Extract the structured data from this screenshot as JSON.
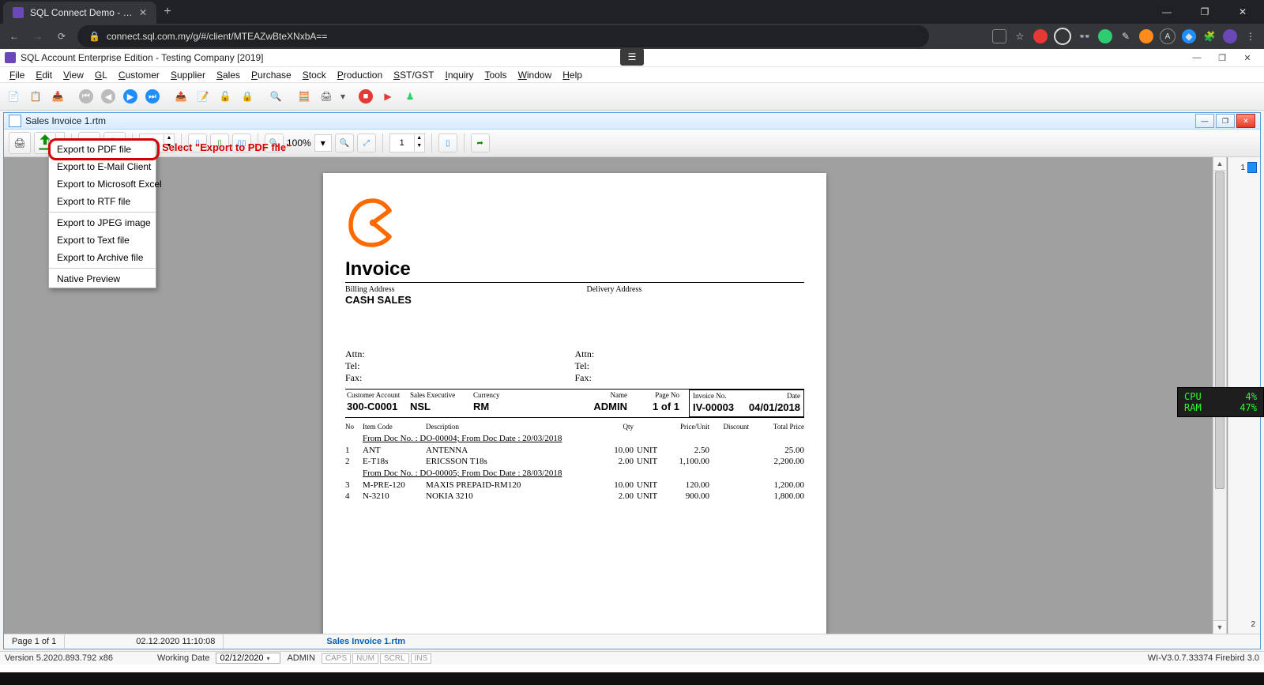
{
  "chrome": {
    "tab_title": "SQL Connect Demo - SQL ACC",
    "url_display": "connect.sql.com.my/g/#/client/MTEAZwBteXNxbA=="
  },
  "app": {
    "title": "SQL Account Enterprise Edition - Testing Company [2019]",
    "menubar": [
      "File",
      "Edit",
      "View",
      "GL",
      "Customer",
      "Supplier",
      "Sales",
      "Purchase",
      "Stock",
      "Production",
      "SST/GST",
      "Inquiry",
      "Tools",
      "Window",
      "Help"
    ]
  },
  "child": {
    "title": "Sales Invoice 1.rtm"
  },
  "preview_toolbar": {
    "page_spin": "1",
    "zoom_label": "100%",
    "copies_spin": "1"
  },
  "export_menu": {
    "items_group1": [
      "Export to PDF file",
      "Export to E-Mail Client",
      "Export to Microsoft Excel",
      "Export to RTF file"
    ],
    "items_group2": [
      "Export to JPEG image",
      "Export to Text file",
      "Export to Archive file"
    ],
    "items_group3": [
      "Native Preview"
    ],
    "annotation_label": "Select \"Export to PDF file\""
  },
  "invoice": {
    "title": "Invoice",
    "billing_label": "Billing Address",
    "billing_name": "CASH SALES",
    "delivery_label": "Delivery Address",
    "attn_label": "Attn:",
    "tel_label": "Tel:",
    "fax_label": "Fax:",
    "meta": {
      "cust_acct_h": "Customer Account",
      "cust_acct_v": "300-C0001",
      "sales_exec_h": "Sales Executive",
      "sales_exec_v": "NSL",
      "currency_h": "Currency",
      "currency_v": "RM",
      "name_h": "Name",
      "name_v": "ADMIN",
      "page_h": "Page No",
      "page_v": "1 of 1",
      "inv_h": "Invoice No.",
      "inv_v": "IV-00003",
      "date_h": "Date",
      "date_v": "04/01/2018"
    },
    "columns": {
      "no": "No",
      "code": "Item Code",
      "desc": "Description",
      "qty": "Qty",
      "pu": "Price/Unit",
      "disc": "Discount",
      "tot": "Total Price"
    },
    "groups": [
      {
        "from": "From Doc No. : DO-00004;   From Doc Date : 20/03/2018",
        "rows": [
          {
            "no": "1",
            "code": "ANT",
            "desc": "ANTENNA",
            "qty": "10.00",
            "uom": "UNIT",
            "pu": "2.50",
            "disc": "",
            "tot": "25.00"
          },
          {
            "no": "2",
            "code": "E-T18s",
            "desc": "ERICSSON T18s",
            "qty": "2.00",
            "uom": "UNIT",
            "pu": "1,100.00",
            "disc": "",
            "tot": "2,200.00"
          }
        ]
      },
      {
        "from": "From Doc No. : DO-00005;   From Doc Date : 28/03/2018",
        "rows": [
          {
            "no": "3",
            "code": "M-PRE-120",
            "desc": "MAXIS PREPAID-RM120",
            "qty": "10.00",
            "uom": "UNIT",
            "pu": "120.00",
            "disc": "",
            "tot": "1,200.00"
          },
          {
            "no": "4",
            "code": "N-3210",
            "desc": "NOKIA 3210",
            "qty": "2.00",
            "uom": "UNIT",
            "pu": "900.00",
            "disc": "",
            "tot": "1,800.00"
          }
        ]
      }
    ]
  },
  "ruler": {
    "page_marker": "1",
    "page_marker_2": "2"
  },
  "preview_status": {
    "page": "Page 1 of 1",
    "timestamp": "02.12.2020 11:10:08",
    "file": "Sales Invoice 1.rtm"
  },
  "app_status": {
    "version": "Version 5.2020.893.792 x86",
    "working_date_label": "Working Date",
    "working_date": "02/12/2020",
    "user": "ADMIN",
    "indicators": [
      "CAPS",
      "NUM",
      "SCRL",
      "INS"
    ],
    "build": "WI-V3.0.7.33374 Firebird 3.0"
  },
  "sysmon": {
    "cpu_label": "CPU",
    "cpu_val": "4%",
    "ram_label": "RAM",
    "ram_val": "47%"
  }
}
